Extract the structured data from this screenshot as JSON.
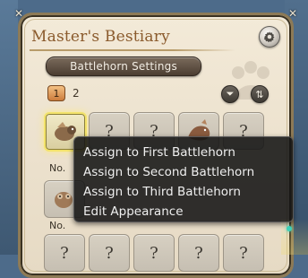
{
  "window": {
    "title": "Master's Bestiary",
    "settings_button_label": "Battlehorn Settings",
    "page_tabs": [
      "1",
      "2"
    ],
    "active_page": 1
  },
  "toolbar": {
    "filter_icon": "filter-icon",
    "sort_icon": "sort-icon"
  },
  "grid": {
    "rows": [
      [
        "minion-1",
        "?",
        "?",
        "minion-2",
        "?"
      ],
      [
        "minion-3",
        "",
        "",
        "",
        ""
      ],
      [
        "?",
        "?",
        "?",
        "?",
        "?"
      ]
    ],
    "labels": [
      "No.",
      "No."
    ]
  },
  "context_menu": {
    "items": [
      "Assign to First Battlehorn",
      "Assign to Second Battlehorn",
      "Assign to Third Battlehorn",
      "Edit Appearance"
    ]
  }
}
